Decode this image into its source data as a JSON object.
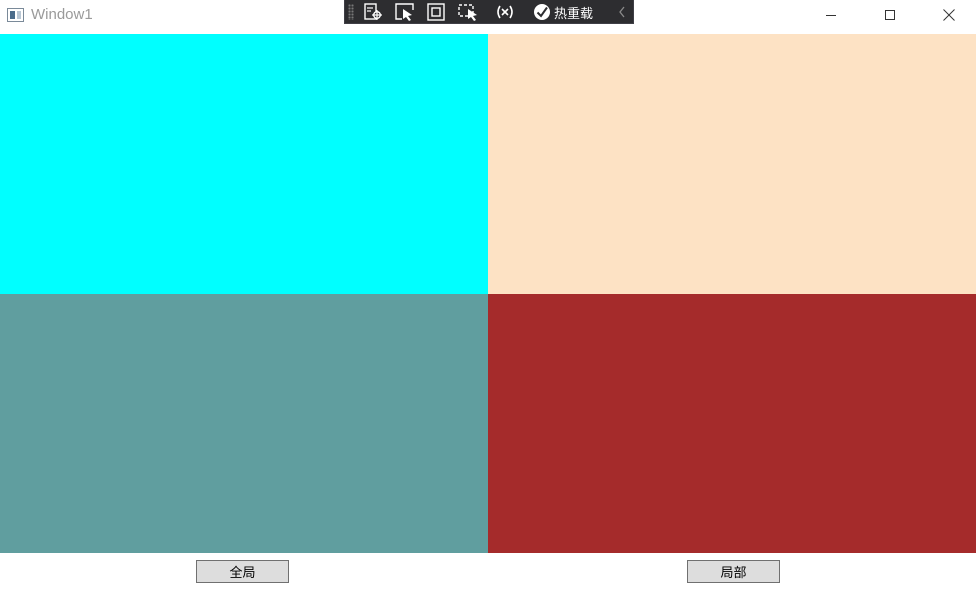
{
  "window": {
    "title": "Window1"
  },
  "debug_toolbar": {
    "hot_reload_label": "热重载",
    "icons": [
      "live-visual-tree-icon",
      "select-element-icon",
      "display-layout-adorners-icon",
      "track-focused-element-icon",
      "binding-failures-icon",
      "hot-reload-check-icon",
      "collapse-chevron-icon"
    ]
  },
  "caption_buttons": {
    "icons": [
      "minimize-icon",
      "maximize-icon",
      "close-icon"
    ]
  },
  "panels": {
    "top_left": {
      "color": "#00FFFF"
    },
    "top_right": {
      "color": "#FDE2C4"
    },
    "bottom_left": {
      "color": "#609E9F"
    },
    "bottom_right": {
      "color": "#A52B2B"
    }
  },
  "buttons": {
    "global_label": "全局",
    "local_label": "局部"
  }
}
